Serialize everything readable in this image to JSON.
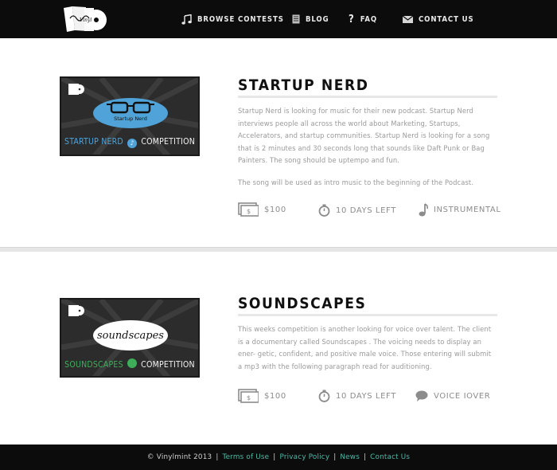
{
  "nav": {
    "items": [
      {
        "label": "BROWSE CONTESTS",
        "icon": "music-note-icon"
      },
      {
        "label": "BLOG",
        "icon": "document-icon"
      },
      {
        "label": "FAQ",
        "icon": "question-icon"
      },
      {
        "label": "CONTACT US",
        "icon": "envelope-icon"
      }
    ]
  },
  "contests": [
    {
      "title": "STARTUP NERD",
      "thumb_oval_text": "Startup Nerd",
      "thumb_caption_left": "STARTUP NERD",
      "thumb_caption_right": "COMPETITION",
      "thumb_caption_color": "#4fa3d9",
      "thumb_oval_color": "#4fa3d9",
      "description": [
        "Startup Nerd is looking for music for their new podcast. Startup Nerd interviews people all across the world about Marketing, Startups, Accelerators, and startup communities. Startup Nerd is looking for a song that is 2 minutes and 30 seconds long that sounds like Daft Punk or Bag Painters. The song should be uptempo and fun.",
        "The song will be used as intro music to the beginning of the Podcast."
      ],
      "prize": "$100",
      "time_left": "10 DAYS LEFT",
      "category": "INSTRUMENTAL",
      "category_icon": "music-note-icon"
    },
    {
      "title": "SOUNDSCAPES",
      "thumb_oval_text": "soundscapes",
      "thumb_caption_left": "SOUNDSCAPES",
      "thumb_caption_right": "COMPETITION",
      "thumb_caption_color": "#3fae5a",
      "thumb_oval_color": "#ffffff",
      "description": [
        "This weeks competition is another looking for voice over talent. The client is a documentary called Soundscapes . The voicing needs to display an ener- getic, confident, and positive male voice. Those entering will submit a mp3 with the following paragraph read for auditioning."
      ],
      "prize": "$100",
      "time_left": "10 DAYS LEFT",
      "category": "VOICE IOVER",
      "category_icon": "speech-bubble-icon"
    }
  ],
  "footer": {
    "copyright": "© Vinylmint 2013",
    "links": [
      "Terms of Use",
      "Privacy Policy",
      "News",
      "Contact Us"
    ],
    "link_color": "#4fb9a8"
  }
}
